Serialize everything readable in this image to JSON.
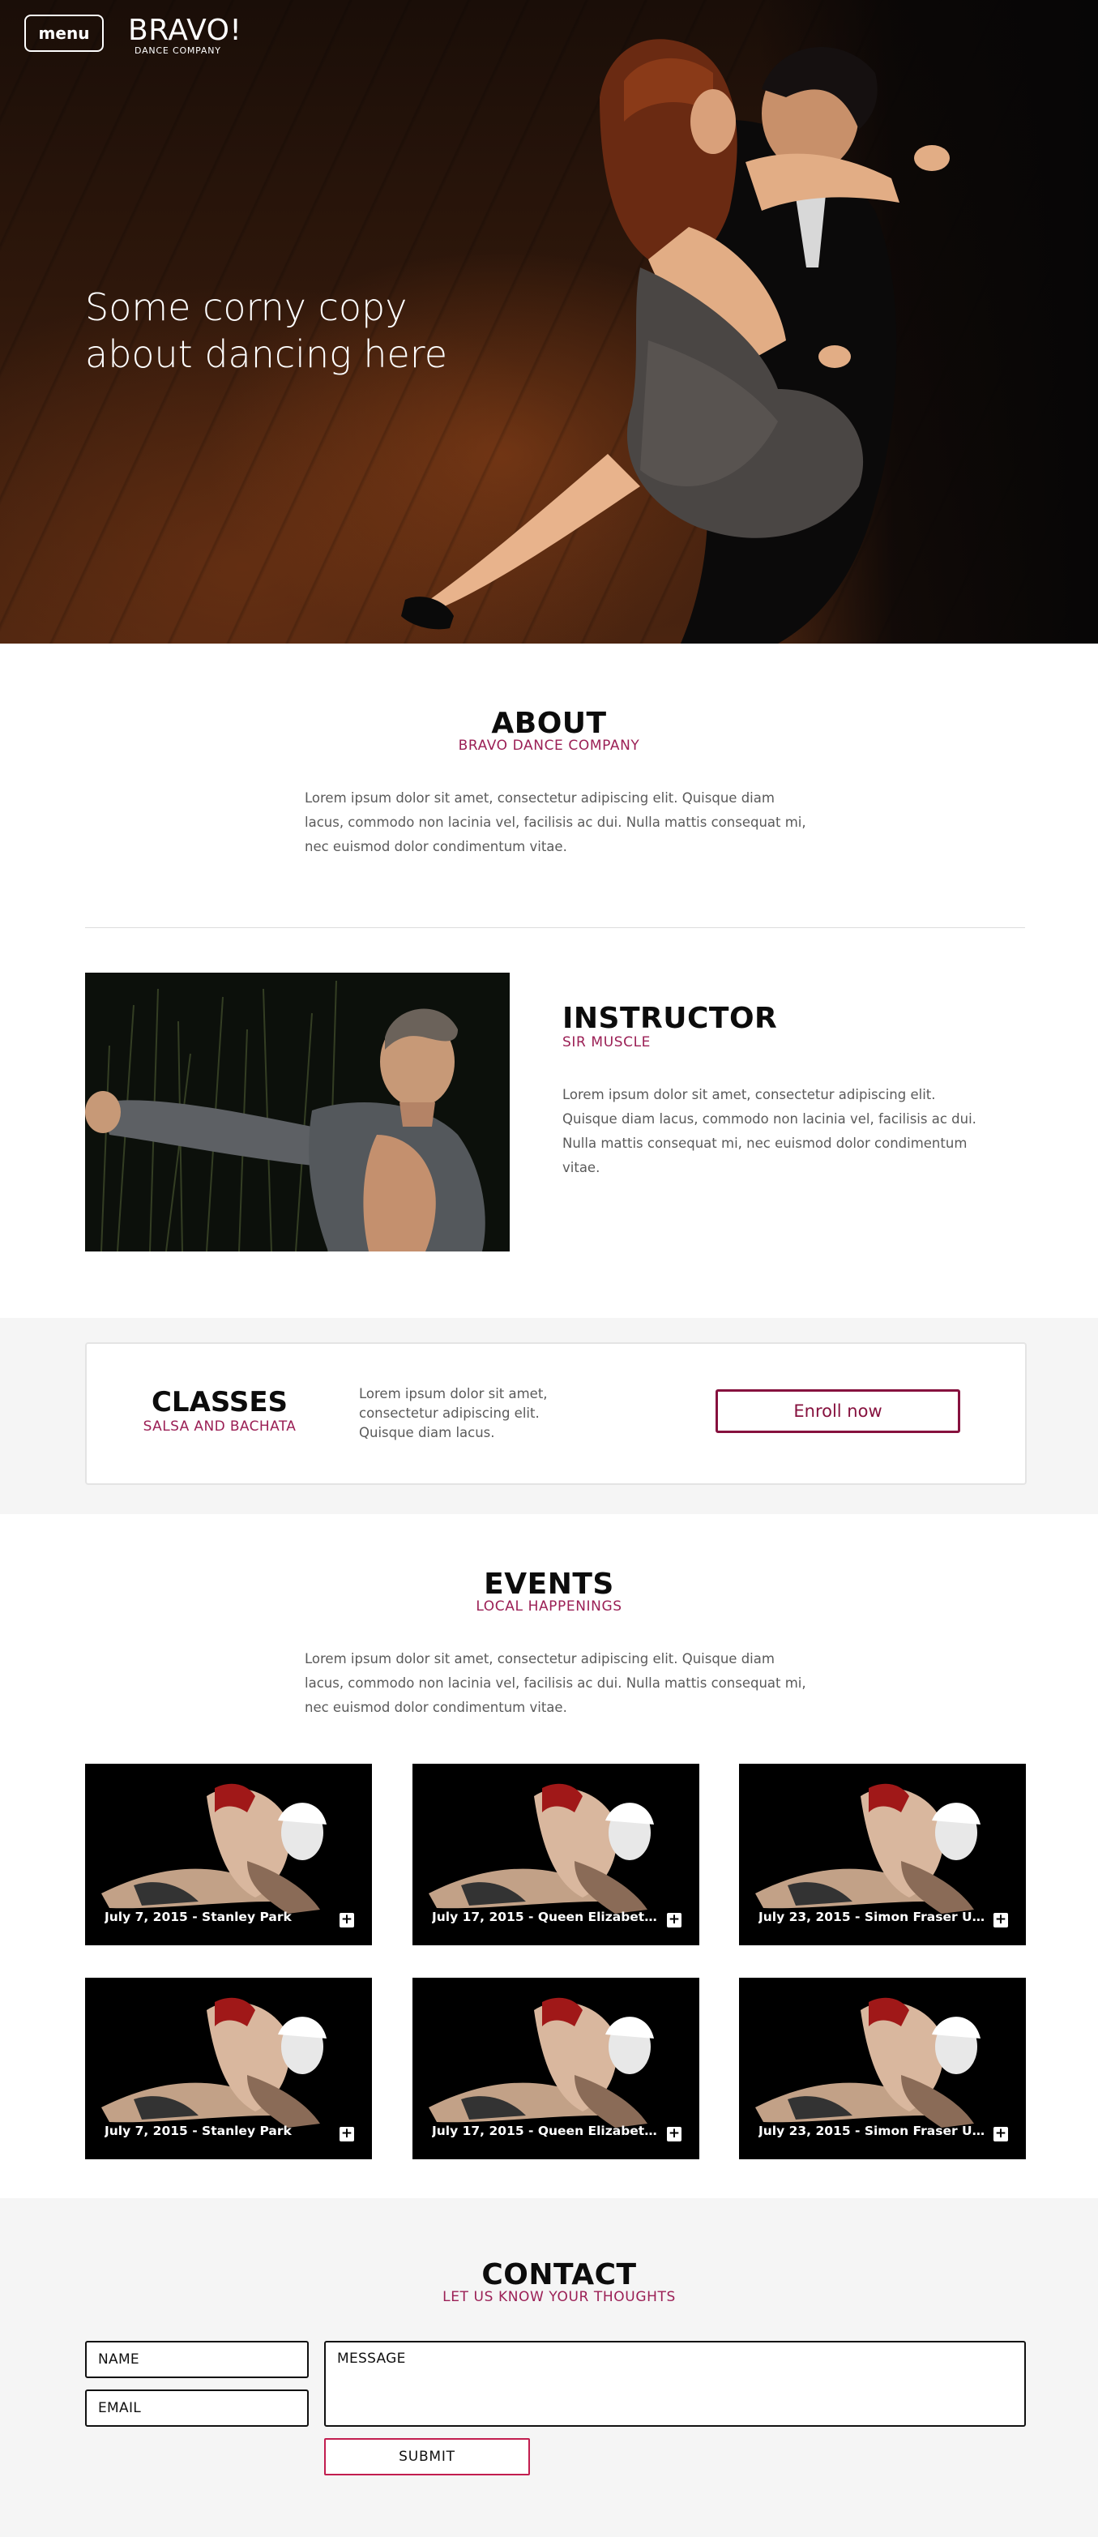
{
  "header": {
    "menu_label": "menu",
    "logo_title": "BRAVO!",
    "logo_subtitle": "DANCE COMPANY",
    "hero_line1": "Some corny copy",
    "hero_line2": "about dancing here"
  },
  "about": {
    "title": "ABOUT",
    "subtitle": "BRAVO DANCE COMPANY",
    "lines": [
      "Lorem ipsum dolor sit amet, consectetur adipiscing elit. Quisque diam",
      "lacus, commodo non lacinia vel, facilisis ac dui. Nulla mattis consequat mi,",
      "nec euismod dolor condimentum vitae."
    ]
  },
  "instructor": {
    "title": "INSTRUCTOR",
    "subtitle": "SIR MUSCLE",
    "lines": [
      "Lorem ipsum dolor sit amet, consectetur adipiscing elit.",
      "Quisque diam lacus, commodo non lacinia vel, facilisis ac dui.",
      "Nulla mattis consequat mi, nec euismod dolor condimentum",
      "vitae."
    ]
  },
  "classes": {
    "title": "CLASSES",
    "subtitle": "SALSA AND BACHATA",
    "lines": [
      "Lorem ipsum dolor sit amet,",
      "consectetur adipiscing elit.",
      "Quisque diam lacus."
    ],
    "enroll_label": "Enroll now"
  },
  "events": {
    "title": "EVENTS",
    "subtitle": "LOCAL HAPPENINGS",
    "lines": [
      "Lorem ipsum dolor sit amet, consectetur adipiscing elit. Quisque diam",
      "lacus, commodo non lacinia vel, facilisis ac dui. Nulla mattis consequat mi,",
      "nec euismod dolor condimentum vitae."
    ],
    "items": [
      {
        "label": "July 7, 2015 - Stanley Park"
      },
      {
        "label": "July 17, 2015 - Queen Elizabeth..."
      },
      {
        "label": "July 23, 2015 - Simon Fraser Uni..."
      },
      {
        "label": "July 7, 2015 - Stanley Park"
      },
      {
        "label": "July 17, 2015 - Queen Elizabeth..."
      },
      {
        "label": "July 23, 2015 - Simon Fraser Uni..."
      }
    ],
    "plus_glyph": "+"
  },
  "contact": {
    "title": "CONTACT",
    "subtitle": "LET US KNOW YOUR THOUGHTS",
    "name_placeholder": "NAME",
    "email_placeholder": "EMAIL",
    "message_placeholder": "MESSAGE",
    "submit_label": "SUBMIT"
  },
  "colors": {
    "accent": "#9b1f55",
    "enroll_border": "#86113e",
    "submit_border": "#c21e4f",
    "band_background": "#f5f5f5"
  }
}
